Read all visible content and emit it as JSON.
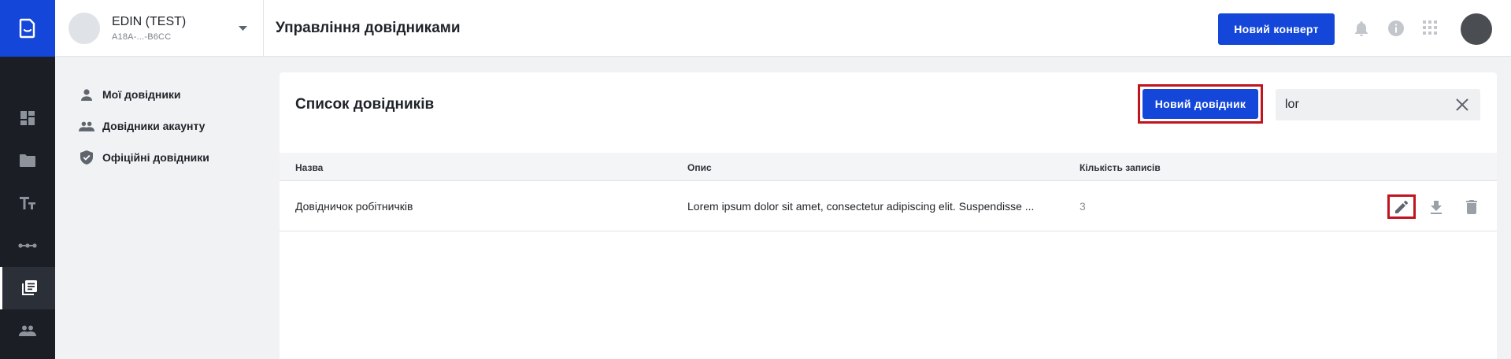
{
  "account": {
    "name": "EDIN (TEST)",
    "id": "A18A-...-B6CC"
  },
  "header": {
    "title": "Управління довідниками",
    "new_envelope_label": "Новий конверт"
  },
  "sidenav": {
    "items": [
      {
        "label": "Мої довідники",
        "icon": "person-icon"
      },
      {
        "label": "Довідники акаунту",
        "icon": "people-icon"
      },
      {
        "label": "Офіційні довідники",
        "icon": "shield-check-icon"
      }
    ]
  },
  "card": {
    "title": "Список довідників",
    "new_reference_label": "Новий довідник",
    "search": {
      "value": "lor",
      "placeholder": ""
    }
  },
  "table": {
    "columns": [
      "Назва",
      "Опис",
      "Кількість записів"
    ],
    "rows": [
      {
        "name": "Довідничок робітничків",
        "description": "Lorem ipsum dolor sit amet, consectetur adipiscing elit. Suspendisse ...",
        "count": "3"
      }
    ]
  },
  "colors": {
    "brand": "#1447d9",
    "highlight": "#c0141f",
    "rail": "#1b1e24"
  }
}
